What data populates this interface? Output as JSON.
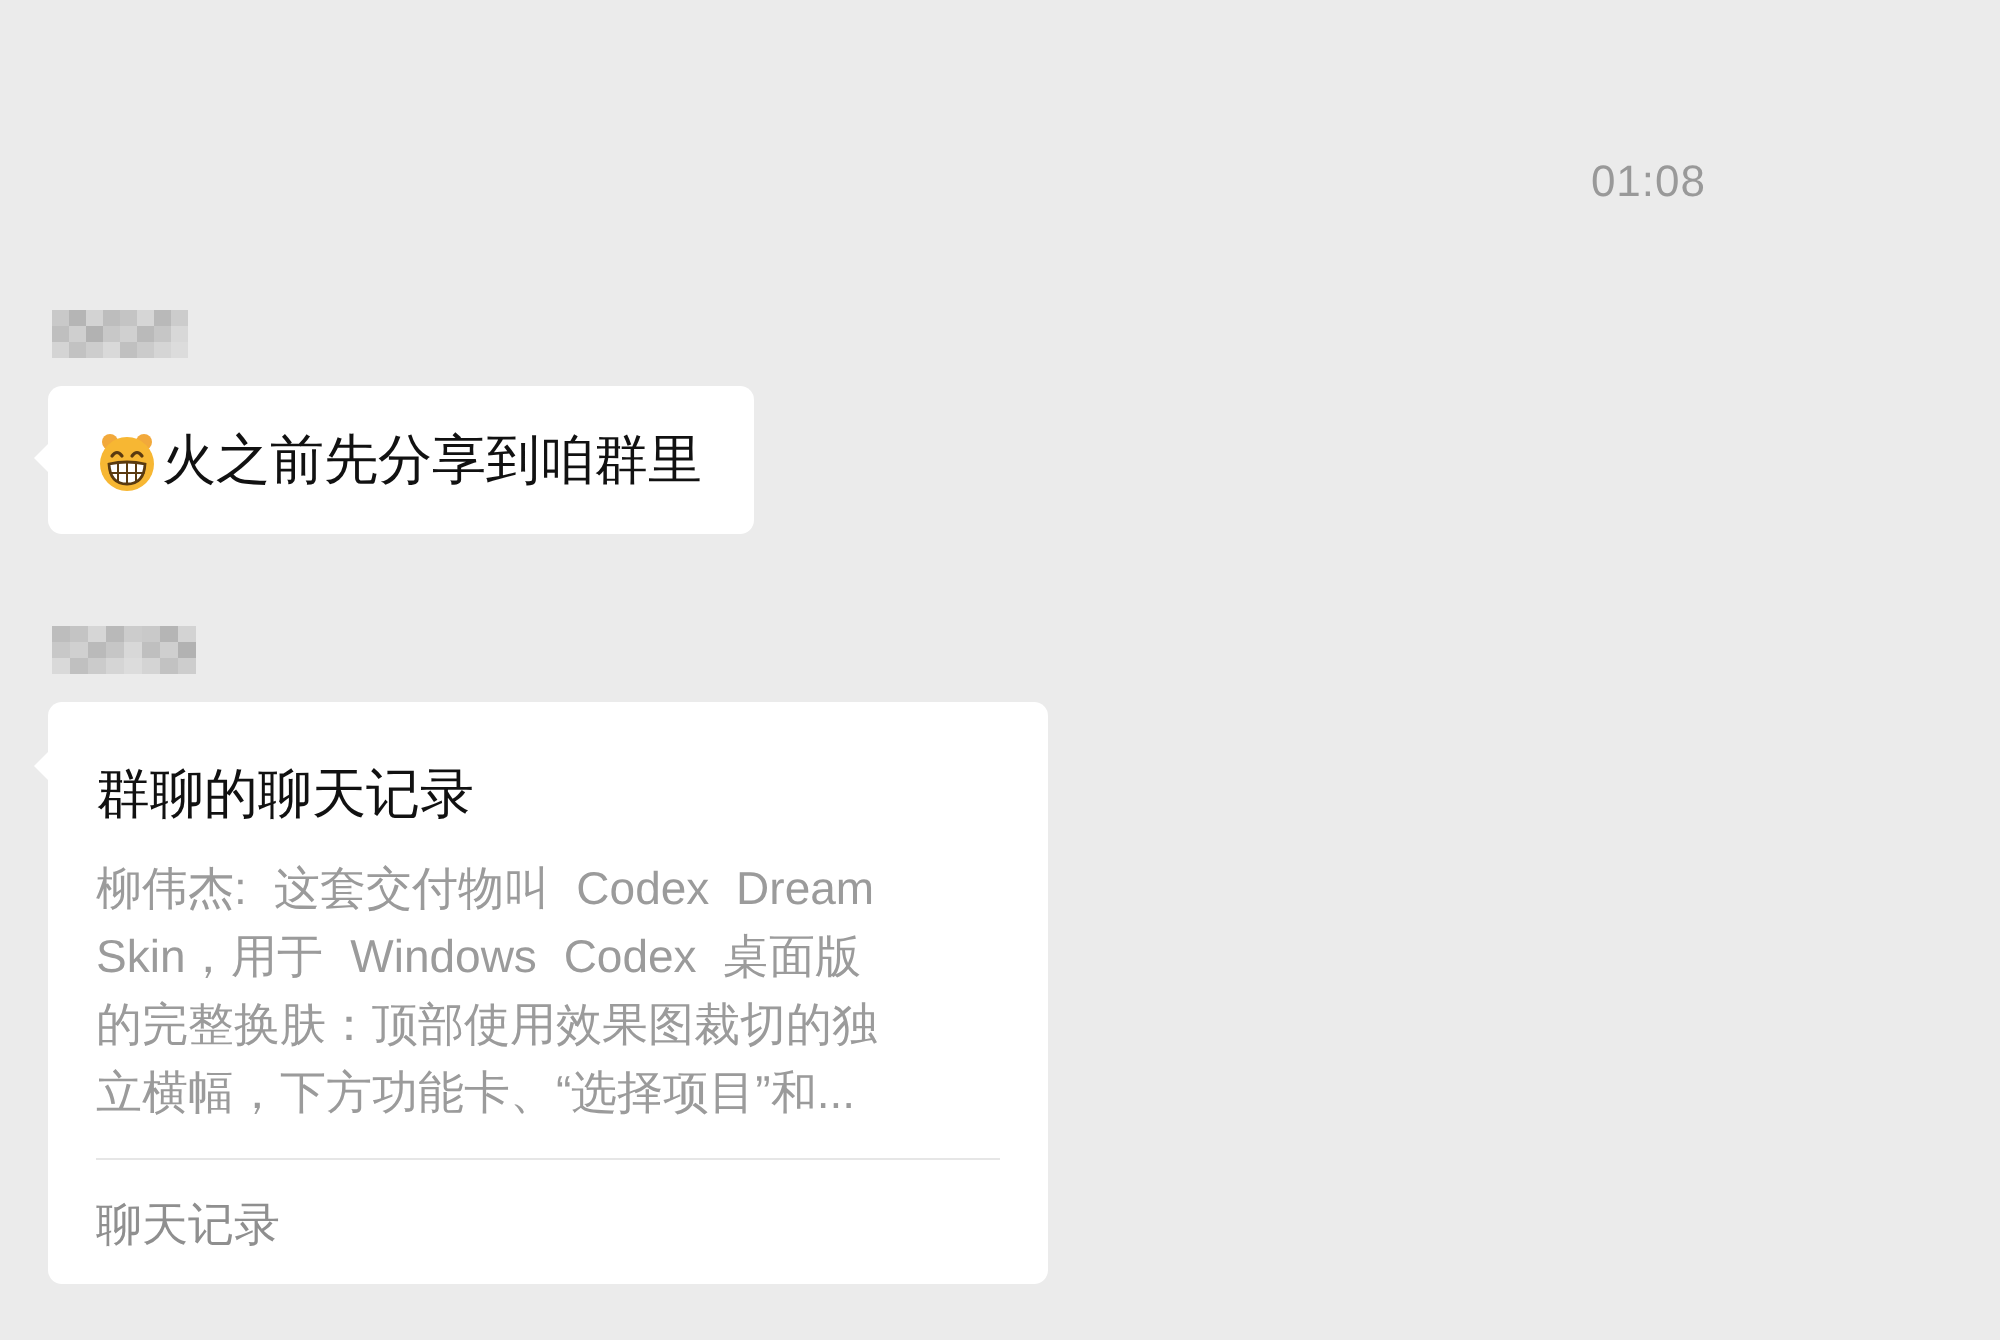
{
  "timestamp": "01:08",
  "messages": [
    {
      "kind": "text",
      "sender_pixelated": true,
      "has_emoji": true,
      "text": "火之前先分享到咱群里"
    },
    {
      "kind": "chat_record",
      "sender_pixelated": true,
      "title": "群聊的聊天记录",
      "preview": "柳伟杰: 这套交付物叫 Codex Dream Skin，用于 Windows Codex 桌面版的完整换肤：顶部使用效果图裁切的独立横幅，下方功能卡、“选择项目”和...",
      "footer": "聊天记录"
    }
  ]
}
